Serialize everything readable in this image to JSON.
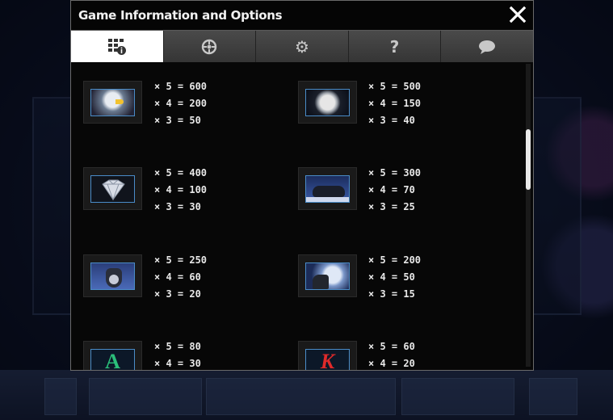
{
  "dialog": {
    "title": "Game Information and Options",
    "close_glyph": "✕"
  },
  "tabs": [
    {
      "name": "paytable",
      "icon": "paytable-info-icon",
      "active": true
    },
    {
      "name": "autoplay",
      "icon": "autoplay-reels-icon",
      "active": false
    },
    {
      "name": "settings",
      "icon": "gear-icon",
      "active": false,
      "glyph": "⚙"
    },
    {
      "name": "help",
      "icon": "question-icon",
      "active": false,
      "glyph": "?"
    },
    {
      "name": "chat",
      "icon": "speech-bubble-icon",
      "active": false
    }
  ],
  "symbols": [
    {
      "name": "eagle",
      "pays": [
        "× 5 = 600",
        "× 4 = 200",
        "× 3 = 50"
      ]
    },
    {
      "name": "moon",
      "pays": [
        "× 5 = 500",
        "× 4 = 150",
        "× 3 = 40"
      ]
    },
    {
      "name": "diamond",
      "pays": [
        "× 5 = 400",
        "× 4 = 100",
        "× 3 = 30"
      ]
    },
    {
      "name": "wolf-pack",
      "pays": [
        "× 5 = 300",
        "× 4 = 70",
        "× 3 = 25"
      ]
    },
    {
      "name": "wolf-face",
      "pays": [
        "× 5 = 250",
        "× 4 = 60",
        "× 3 = 20"
      ]
    },
    {
      "name": "wolf-howl-moon",
      "pays": [
        "× 5 = 200",
        "× 4 = 50",
        "× 3 = 15"
      ]
    },
    {
      "name": "letter-a",
      "letter": "A",
      "pays": [
        "× 5 = 80",
        "× 4 = 30"
      ]
    },
    {
      "name": "letter-k",
      "letter": "K",
      "pays": [
        "× 5 = 60",
        "× 4 = 20"
      ]
    }
  ],
  "colors": {
    "dialog_bg": "#0b0b0b",
    "tab_active": "#ffffff",
    "tab_inactive": "#3e3e3e",
    "symbol_border": "#4a8cc8",
    "letter_a": "#2bbf7a",
    "letter_k": "#e02a2a"
  }
}
